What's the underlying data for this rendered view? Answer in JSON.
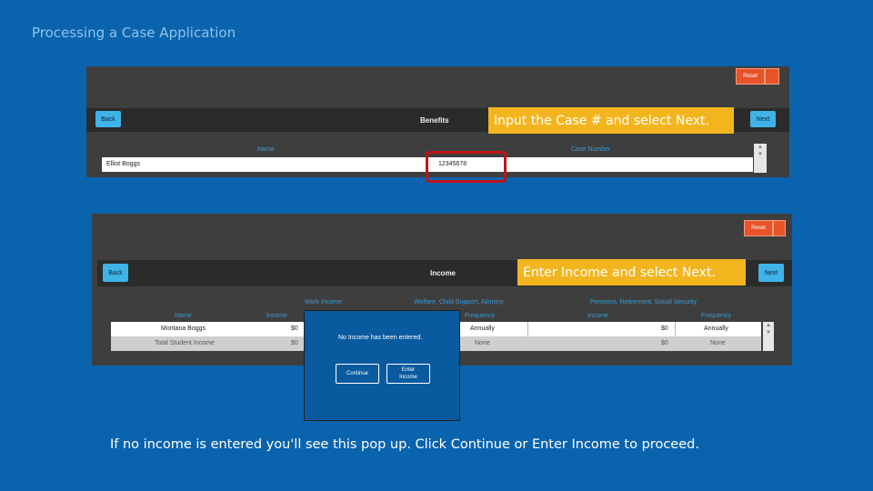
{
  "slide_title": "Processing a Case Application",
  "benefits_screen": {
    "reset_label": "Reset",
    "back_label": "Back",
    "title": "Benefits",
    "next_label": "Next",
    "col_name": "Name",
    "col_case_number": "Case Number",
    "row": {
      "name": "Elliot Boggs",
      "case_number": "12345678"
    },
    "callout": "Input the Case # and select Next."
  },
  "income_screen": {
    "reset_label": "Reset",
    "back_label": "Back",
    "title": "Income",
    "next_label": "Next",
    "callout": "Enter Income and select Next.",
    "group_work": "Work Income",
    "group_welfare": "Welfare, Child Support, Alimony",
    "group_pensions": "Pensions, Retirement, Social Security",
    "col_name": "Name",
    "col_income": "Income",
    "col_frequency": "Frequency",
    "col_income2": "Income",
    "col_frequency2": "Frequency",
    "rows": [
      {
        "name": "Montana Boggs",
        "work_income": "$0",
        "welfare_frequency": "Annually",
        "pension_income": "$0",
        "pension_frequency": "Annually"
      },
      {
        "name": "Total Student Income",
        "work_income": "$0",
        "welfare_frequency": "None",
        "pension_income": "$0",
        "pension_frequency": "None"
      }
    ]
  },
  "popup": {
    "message": "No Income has been entered.",
    "continue_label": "Continue",
    "enter_income_label": "Enter Income"
  },
  "footer_instruction": "If no income is entered you'll see this pop up. Click Continue or Enter Income to proceed.",
  "colors": {
    "background": "#0a63ad",
    "callout": "#f3b51e",
    "accent_button": "#3fb3e8",
    "reset_button": "#e8532a",
    "highlight": "#c0141c"
  }
}
